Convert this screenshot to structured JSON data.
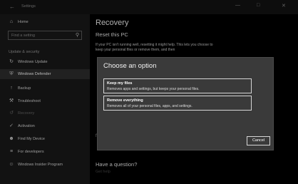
{
  "titlebar": {
    "back_icon": "back-arrow-icon",
    "title": "Settings",
    "minimize": "—",
    "maximize": "□",
    "close": "✕"
  },
  "sidebar": {
    "home": {
      "label": "Home",
      "icon": "home-icon"
    },
    "search": {
      "placeholder": "Find a setting",
      "icon": "search-icon"
    },
    "section_heading": "Update & security",
    "items": [
      {
        "label": "Windows Update",
        "icon": "refresh-icon"
      },
      {
        "label": "Windows Defender",
        "icon": "shield-icon"
      },
      {
        "label": "Backup",
        "icon": "upload-icon"
      },
      {
        "label": "Troubleshoot",
        "icon": "wrench-icon"
      },
      {
        "label": "Recovery",
        "icon": "history-icon"
      },
      {
        "label": "Activation",
        "icon": "check-circle-icon"
      },
      {
        "label": "Find My Device",
        "icon": "person-icon"
      },
      {
        "label": "For developers",
        "icon": "developer-icon"
      },
      {
        "label": "Windows Insider Program",
        "icon": "smiley-icon"
      }
    ]
  },
  "main": {
    "page_title": "Recovery",
    "reset_heading": "Reset this PC",
    "reset_text": "If your PC isn't running well, resetting it might help. This lets you choose to keep your personal files or remove them, and then",
    "side_marker": "f",
    "question": "Have a question?",
    "help_link": "Get help"
  },
  "dialog": {
    "title": "Choose an option",
    "options": [
      {
        "title": "Keep my files",
        "desc": "Removes apps and settings, but keeps your personal files."
      },
      {
        "title": "Remove everything",
        "desc": "Removes all of your personal files, apps, and settings."
      }
    ],
    "cancel": "Cancel"
  }
}
